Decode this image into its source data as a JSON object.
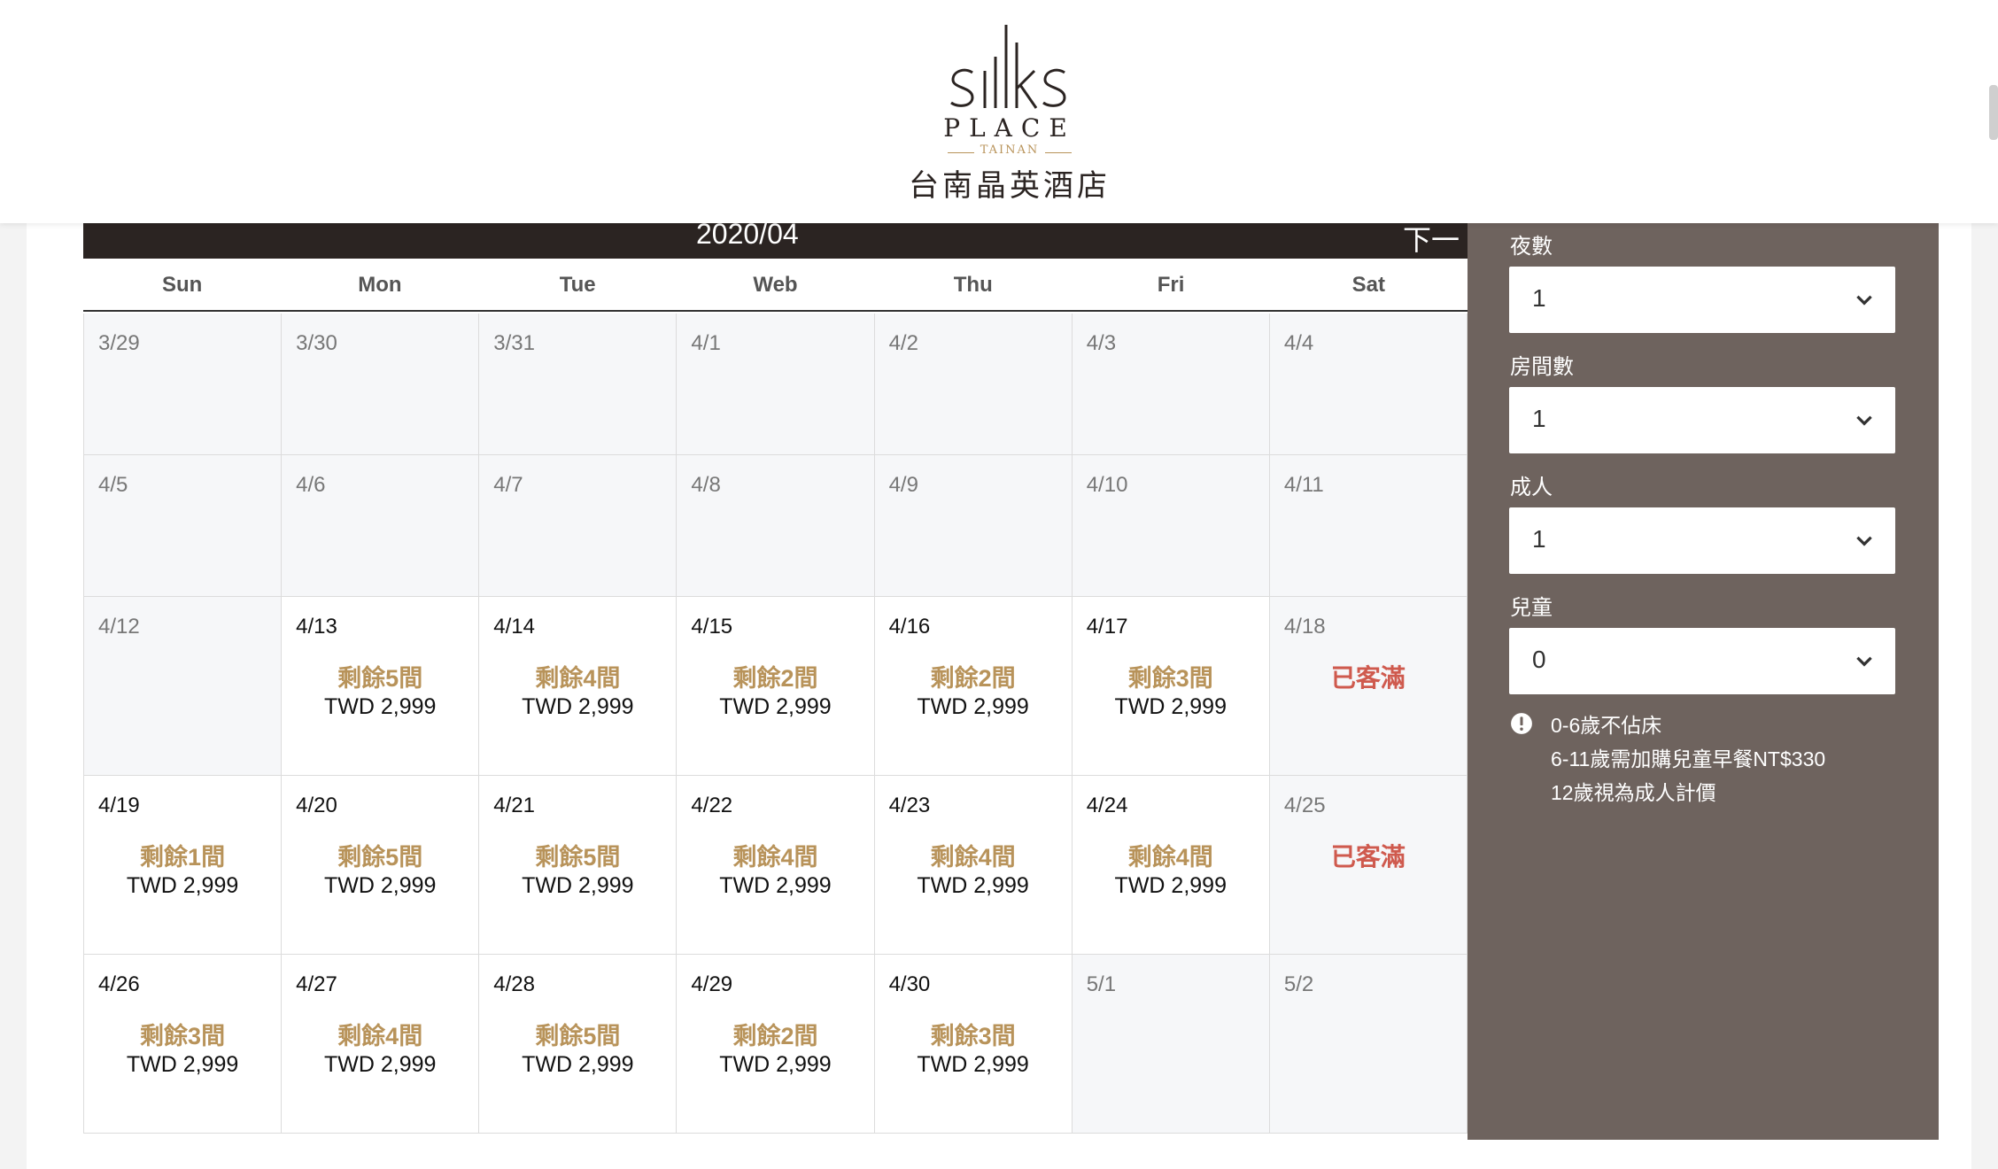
{
  "hotel": {
    "logo_main": "SILKS",
    "logo_place": "PLACE",
    "logo_city": "TAINAN",
    "name_cn": "台南晶英酒店"
  },
  "calendar": {
    "month_label": "2020/04",
    "next_label": "下一個月",
    "weekdays": [
      "Sun",
      "Mon",
      "Tue",
      "Web",
      "Thu",
      "Fri",
      "Sat"
    ],
    "weeks": [
      [
        {
          "date": "3/29",
          "disabled": true
        },
        {
          "date": "3/30",
          "disabled": true
        },
        {
          "date": "3/31",
          "disabled": true
        },
        {
          "date": "4/1",
          "disabled": true
        },
        {
          "date": "4/2",
          "disabled": true
        },
        {
          "date": "4/3",
          "disabled": true
        },
        {
          "date": "4/4",
          "disabled": true
        }
      ],
      [
        {
          "date": "4/5",
          "disabled": true
        },
        {
          "date": "4/6",
          "disabled": true
        },
        {
          "date": "4/7",
          "disabled": true
        },
        {
          "date": "4/8",
          "disabled": true
        },
        {
          "date": "4/9",
          "disabled": true
        },
        {
          "date": "4/10",
          "disabled": true
        },
        {
          "date": "4/11",
          "disabled": true
        }
      ],
      [
        {
          "date": "4/12",
          "disabled": true
        },
        {
          "date": "4/13",
          "remain": "剩餘5間",
          "price": "TWD 2,999"
        },
        {
          "date": "4/14",
          "remain": "剩餘4間",
          "price": "TWD 2,999"
        },
        {
          "date": "4/15",
          "remain": "剩餘2間",
          "price": "TWD 2,999"
        },
        {
          "date": "4/16",
          "remain": "剩餘2間",
          "price": "TWD 2,999"
        },
        {
          "date": "4/17",
          "remain": "剩餘3間",
          "price": "TWD 2,999"
        },
        {
          "date": "4/18",
          "disabled": true,
          "full": "已客滿"
        }
      ],
      [
        {
          "date": "4/19",
          "remain": "剩餘1間",
          "price": "TWD 2,999"
        },
        {
          "date": "4/20",
          "remain": "剩餘5間",
          "price": "TWD 2,999"
        },
        {
          "date": "4/21",
          "remain": "剩餘5間",
          "price": "TWD 2,999"
        },
        {
          "date": "4/22",
          "remain": "剩餘4間",
          "price": "TWD 2,999"
        },
        {
          "date": "4/23",
          "remain": "剩餘4間",
          "price": "TWD 2,999"
        },
        {
          "date": "4/24",
          "remain": "剩餘4間",
          "price": "TWD 2,999"
        },
        {
          "date": "4/25",
          "disabled": true,
          "full": "已客滿"
        }
      ],
      [
        {
          "date": "4/26",
          "remain": "剩餘3間",
          "price": "TWD 2,999"
        },
        {
          "date": "4/27",
          "remain": "剩餘4間",
          "price": "TWD 2,999"
        },
        {
          "date": "4/28",
          "remain": "剩餘5間",
          "price": "TWD 2,999"
        },
        {
          "date": "4/29",
          "remain": "剩餘2間",
          "price": "TWD 2,999"
        },
        {
          "date": "4/30",
          "remain": "剩餘3間",
          "price": "TWD 2,999"
        },
        {
          "date": "5/1",
          "disabled": true
        },
        {
          "date": "5/2",
          "disabled": true
        }
      ]
    ]
  },
  "booking": {
    "nights": {
      "label": "夜數",
      "value": "1"
    },
    "rooms": {
      "label": "房間數",
      "value": "1"
    },
    "adults": {
      "label": "成人",
      "value": "1"
    },
    "children": {
      "label": "兒童",
      "value": "0"
    },
    "notes": [
      "0-6歲不佔床",
      "6-11歲需加購兒童早餐NT$330",
      "12歲視為成人計價"
    ]
  },
  "colors": {
    "accent_gold": "#b8935a",
    "full_red": "#cf5a4e",
    "sidebar_bg": "#6e635e",
    "header_bar": "#2b2422"
  }
}
